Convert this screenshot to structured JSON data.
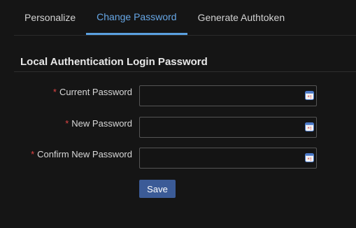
{
  "tabs": [
    {
      "label": "Personalize",
      "active": false
    },
    {
      "label": "Change Password",
      "active": true
    },
    {
      "label": "Generate Authtoken",
      "active": false
    }
  ],
  "section": {
    "title": "Local Authentication Login Password"
  },
  "form": {
    "required_marker": "*",
    "fields": [
      {
        "label": "Current Password",
        "value": ""
      },
      {
        "label": "New Password",
        "value": ""
      },
      {
        "label": "Confirm New Password",
        "value": ""
      }
    ],
    "field_icon": "password-manager-icon",
    "save_label": "Save"
  },
  "colors": {
    "background": "#151515",
    "active_tab": "#67a7e6",
    "required": "#e04545",
    "save_button": "#3b5b97"
  }
}
